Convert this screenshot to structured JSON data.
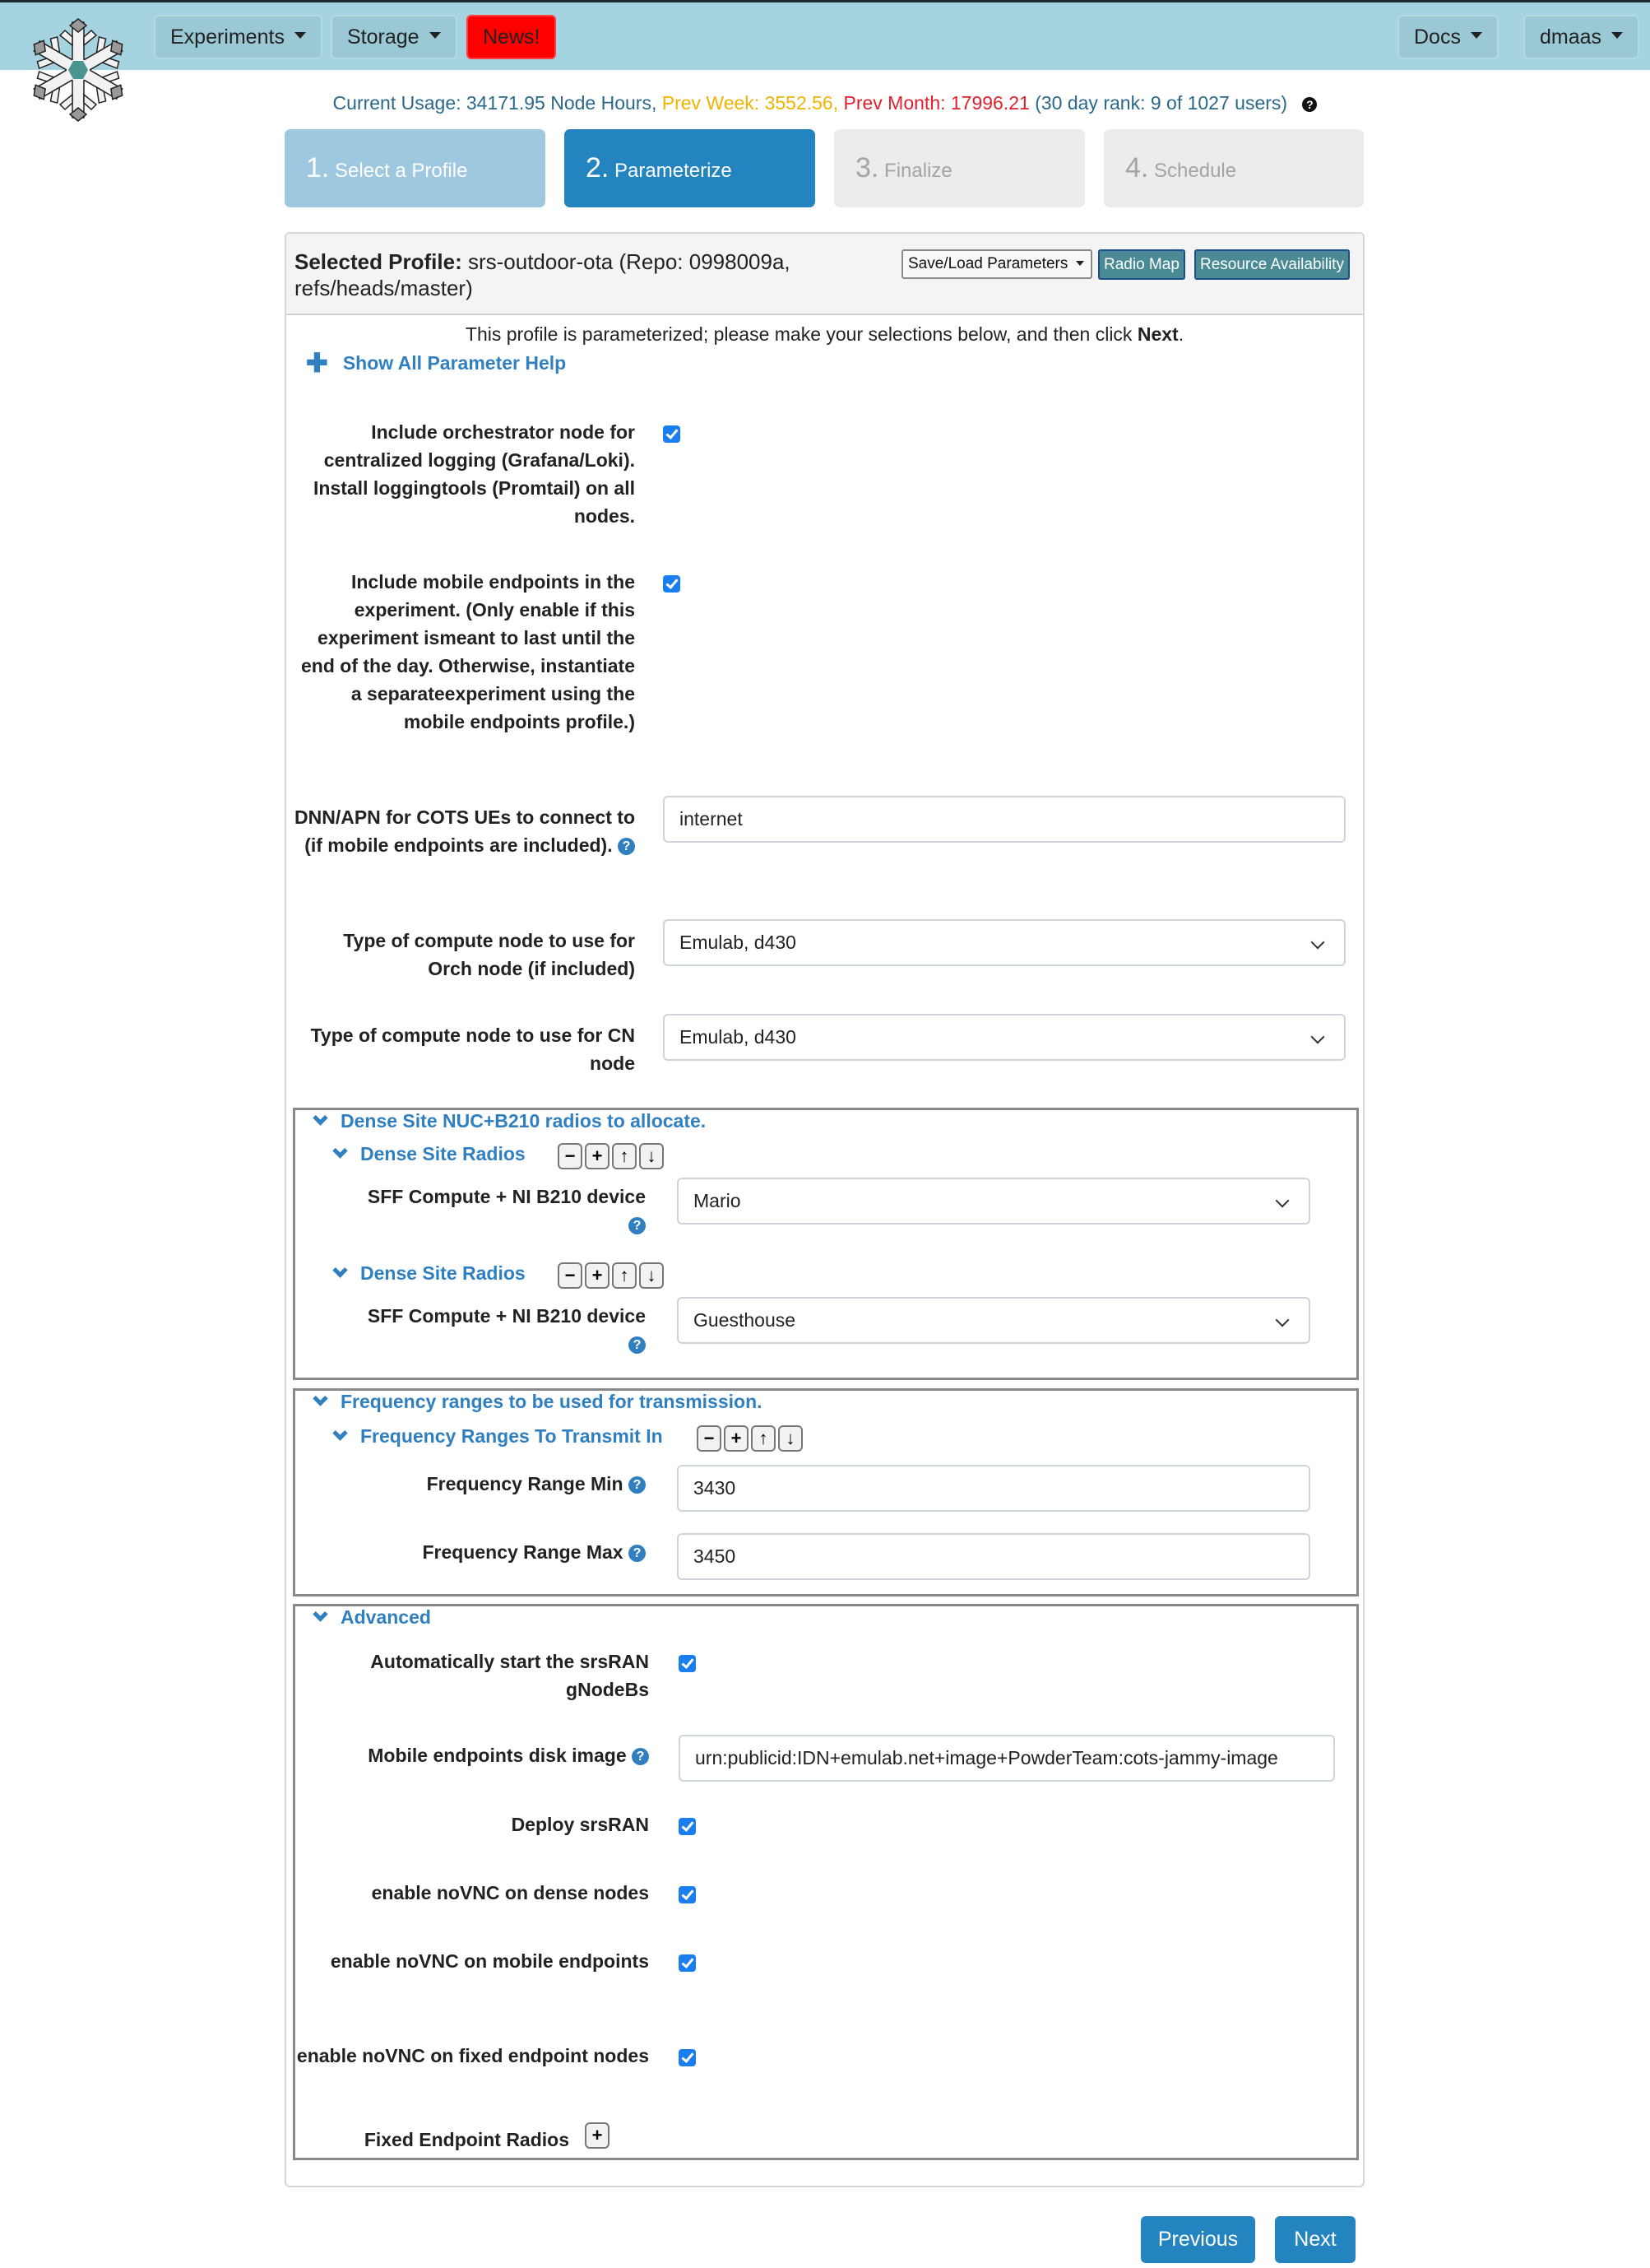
{
  "nav": {
    "left": [
      {
        "label": "Experiments",
        "dropdown": true
      },
      {
        "label": "Storage",
        "dropdown": true
      },
      {
        "label": "News!",
        "dropdown": false
      }
    ],
    "right": [
      {
        "label": "Docs",
        "dropdown": true
      },
      {
        "label": "dmaas",
        "dropdown": true
      }
    ]
  },
  "usage": {
    "current": "Current Usage: 34171.95 Node Hours,",
    "prev_week": "Prev Week: 3552.56,",
    "prev_month": "Prev Month: 17996.21",
    "rank": "(30 day rank: 9 of 1027 users)",
    "help_icon": "?"
  },
  "steps": [
    {
      "num": "1.",
      "label": "Select a Profile",
      "state": "done"
    },
    {
      "num": "2.",
      "label": "Parameterize",
      "state": "active"
    },
    {
      "num": "3.",
      "label": "Finalize",
      "state": "todo"
    },
    {
      "num": "4.",
      "label": "Schedule",
      "state": "todo"
    }
  ],
  "panel": {
    "title_bold": "Selected Profile:",
    "title_rest": "srs-outdoor-ota (Repo: 0998009a, refs/heads/master)",
    "save_load": "Save/Load Parameters",
    "radio_map": "Radio Map",
    "resource_availability": "Resource Availability",
    "intro_text": "This profile is parameterized; please make your selections below, and then click",
    "intro_bold": "Next",
    "intro_end": ".",
    "show_help": "Show All Parameter Help"
  },
  "params": {
    "orch_logging": {
      "label": "Include orchestrator node for centralized logging (Grafana/Loki). Install loggingtools (Promtail) on all nodes.",
      "checked": true
    },
    "mobile_endpoints": {
      "label": "Include mobile endpoints in the experiment. (Only enable if this experiment ismeant to last until the end of the day. Otherwise, instantiate a separateexperiment using the mobile endpoints profile.)",
      "checked": true
    },
    "dnn_apn": {
      "label": "DNN/APN for COTS UEs to connect to (if mobile endpoints are included).",
      "value": "internet"
    },
    "orch_node_type": {
      "label": "Type of compute node to use for Orch node (if included)",
      "value": "Emulab, d430"
    },
    "cn_node_type": {
      "label": "Type of compute node to use for CN node",
      "value": "Emulab, d430"
    }
  },
  "dense_site": {
    "title": "Dense Site NUC+B210 radios to allocate.",
    "groups": [
      {
        "title": "Dense Site Radios",
        "field_label": "SFF Compute + NI B210 device",
        "value": "Mario"
      },
      {
        "title": "Dense Site Radios",
        "field_label": "SFF Compute + NI B210 device",
        "value": "Guesthouse"
      }
    ]
  },
  "frequency": {
    "title": "Frequency ranges to be used for transmission.",
    "group_title": "Frequency Ranges To Transmit In",
    "min_label": "Frequency Range Min",
    "min_value": "3430",
    "max_label": "Frequency Range Max",
    "max_value": "3450"
  },
  "advanced": {
    "title": "Advanced",
    "auto_start": {
      "label": "Automatically start the srsRAN gNodeBs",
      "checked": true
    },
    "disk_image": {
      "label": "Mobile endpoints disk image",
      "value": "urn:publicid:IDN+emulab.net+image+PowderTeam:cots-jammy-image"
    },
    "deploy_srsran": {
      "label": "Deploy srsRAN",
      "checked": true
    },
    "novnc_dense": {
      "label": "enable noVNC on dense nodes",
      "checked": true
    },
    "novnc_mobile": {
      "label": "enable noVNC on mobile endpoints",
      "checked": true
    },
    "novnc_fixed": {
      "label": "enable noVNC on fixed endpoint nodes",
      "checked": true
    },
    "fixed_radios": {
      "label": "Fixed Endpoint Radios"
    }
  },
  "ctrl_glyphs": {
    "remove": "−",
    "add": "+",
    "up": "↑",
    "down": "↓"
  },
  "footer": {
    "previous": "Previous",
    "next": "Next"
  },
  "colors": {
    "header_bg": "#a6d3e0",
    "news": "#ff0000",
    "primary": "#2384c0",
    "link": "#2f7fc1",
    "teal_button": "#4a8a94",
    "checkbox": "#1a7ef0"
  }
}
